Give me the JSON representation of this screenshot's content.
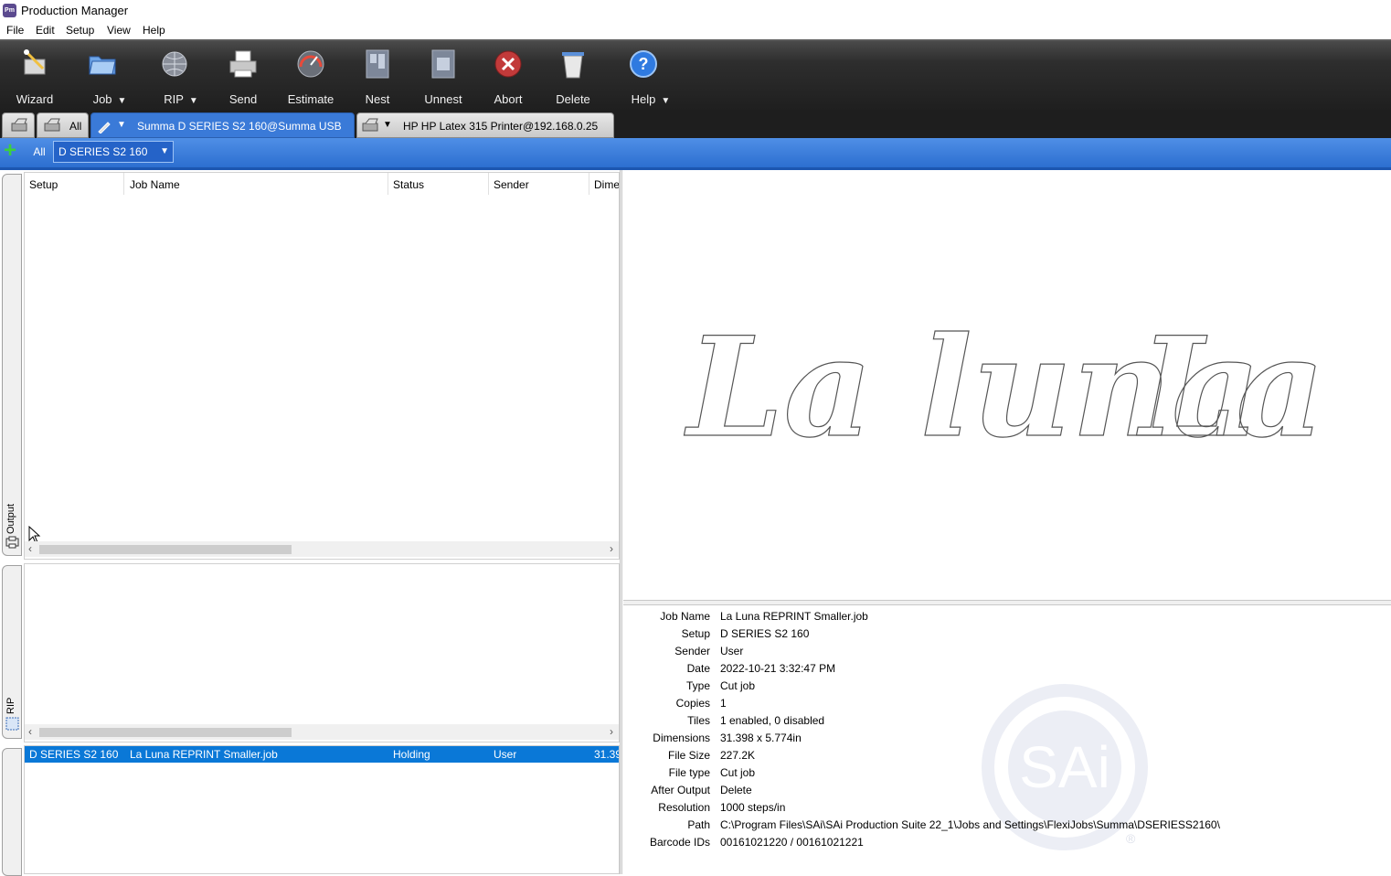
{
  "window": {
    "title": "Production Manager",
    "icon_text": "Pm"
  },
  "menu": {
    "file": "File",
    "edit": "Edit",
    "setup": "Setup",
    "view": "View",
    "help": "Help"
  },
  "toolbar": {
    "wizard": "Wizard",
    "job": "Job",
    "rip": "RIP",
    "send": "Send",
    "estimate": "Estimate",
    "nest": "Nest",
    "unnest": "Unnest",
    "abort": "Abort",
    "delete": "Delete",
    "help": "Help"
  },
  "device_tabs": {
    "all": "All",
    "summa": "Summa D SERIES S2 160@Summa USB",
    "hp": "HP HP Latex 315 Printer@192.168.0.25"
  },
  "filter": {
    "all": "All",
    "setup": "D SERIES S2 160"
  },
  "side_tabs": {
    "output": "Output",
    "rip": "RIP"
  },
  "columns": {
    "setup": "Setup",
    "job_name": "Job Name",
    "status": "Status",
    "sender": "Sender",
    "dimensions": "Dime"
  },
  "hold_queue": [
    {
      "setup": "D SERIES S2 160",
      "job_name": "La Luna REPRINT Smaller.job",
      "status": "Holding",
      "sender": "User",
      "dimensions": "31.39"
    }
  ],
  "properties": [
    {
      "key": "Job Name",
      "value": "La Luna REPRINT Smaller.job"
    },
    {
      "key": "Setup",
      "value": "D SERIES S2 160"
    },
    {
      "key": "Sender",
      "value": "User"
    },
    {
      "key": "Date",
      "value": "2022-10-21 3:32:47 PM"
    },
    {
      "key": "Type",
      "value": "Cut job"
    },
    {
      "key": "Copies",
      "value": "1"
    },
    {
      "key": "Tiles",
      "value": "1 enabled, 0 disabled"
    },
    {
      "key": "Dimensions",
      "value": "31.398 x 5.774in"
    },
    {
      "key": "File Size",
      "value": "227.2K"
    },
    {
      "key": "File type",
      "value": "Cut job"
    },
    {
      "key": "After Output",
      "value": "Delete"
    },
    {
      "key": "Resolution",
      "value": "1000 steps/in"
    },
    {
      "key": "Path",
      "value": "C:\\Program Files\\SAi\\SAi Production Suite 22_1\\Jobs and Settings\\FlexiJobs\\Summa\\DSERIESS2160\\"
    },
    {
      "key": "Barcode IDs",
      "value": "00161021220 / 00161021221"
    }
  ],
  "preview": {
    "text_1": "La luna",
    "text_2": "La"
  },
  "watermark": {
    "text": "SAi",
    "mark": "®"
  },
  "colors": {
    "accent": "#2c6fd0",
    "selection": "#0a78d7",
    "toolbar": "#1f1f1f"
  }
}
